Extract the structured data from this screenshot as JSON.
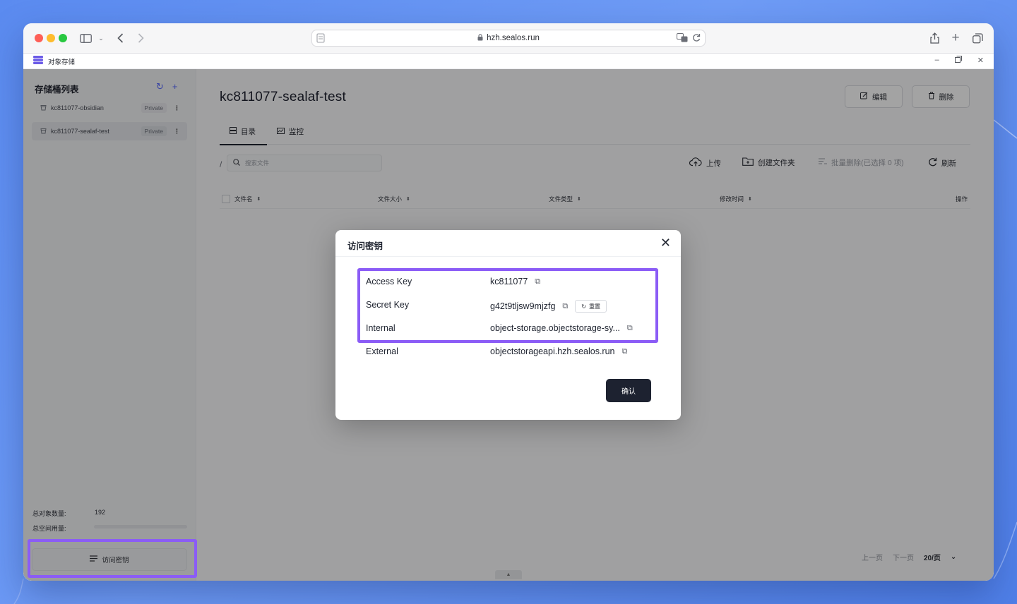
{
  "browser": {
    "url": "hzh.sealos.run"
  },
  "app": {
    "title": "对象存储"
  },
  "sidebar": {
    "title": "存储桶列表",
    "buckets": [
      {
        "name": "kc811077-obsidian",
        "tag": "Private"
      },
      {
        "name": "kc811077-sealaf-test",
        "tag": "Private"
      }
    ],
    "stats": {
      "objects_label": "总对象数量:",
      "objects_value": "192",
      "space_label": "总空间用量:"
    },
    "access_key_button": "访问密钥"
  },
  "main": {
    "bucket_title": "kc811077-sealaf-test",
    "edit_label": "编辑",
    "delete_label": "删除",
    "tabs": [
      {
        "label": "目录"
      },
      {
        "label": "监控"
      }
    ],
    "path": "/",
    "search_placeholder": "搜索文件",
    "actions": {
      "upload": "上传",
      "create_folder": "创建文件夹",
      "batch_delete": "批量删除(已选择 0 项)",
      "refresh": "刷新"
    },
    "columns": [
      "文件名",
      "文件大小",
      "文件类型",
      "修改时间",
      "操作"
    ],
    "pager": {
      "prev": "上一页",
      "next": "下一页",
      "per_page": "20/页"
    }
  },
  "modal": {
    "title": "访问密钥",
    "rows": [
      {
        "label": "Access Key",
        "value": "kc811077"
      },
      {
        "label": "Secret Key",
        "value": "g42t9tljsw9mjzfg"
      },
      {
        "label": "Internal",
        "value": "object-storage.objectstorage-sy..."
      },
      {
        "label": "External",
        "value": "objectstorageapi.hzh.sealos.run"
      }
    ],
    "reset_label": "重置",
    "confirm_label": "确认"
  },
  "colors": {
    "highlight": "#8b5cf6",
    "primary_button": "#1d2230",
    "background": "#5b8bf0"
  }
}
